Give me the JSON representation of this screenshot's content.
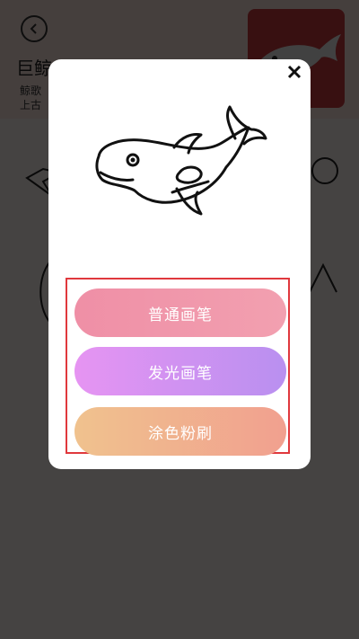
{
  "page": {
    "title_partial": "巨鲸",
    "desc_line1_partial": "鲸歌",
    "desc_line2_partial": "上古"
  },
  "modal": {
    "buttons": [
      {
        "label": "普通画笔"
      },
      {
        "label": "发光画笔"
      },
      {
        "label": "涂色粉刷"
      }
    ]
  },
  "colors": {
    "btn_normal": "#f09aac",
    "btn_glow": "#c792f1",
    "btn_paint": "#f0b48f",
    "highlight_border": "#e0383d"
  },
  "icons": [
    "back-icon",
    "close-icon",
    "dolphin-illustration"
  ]
}
